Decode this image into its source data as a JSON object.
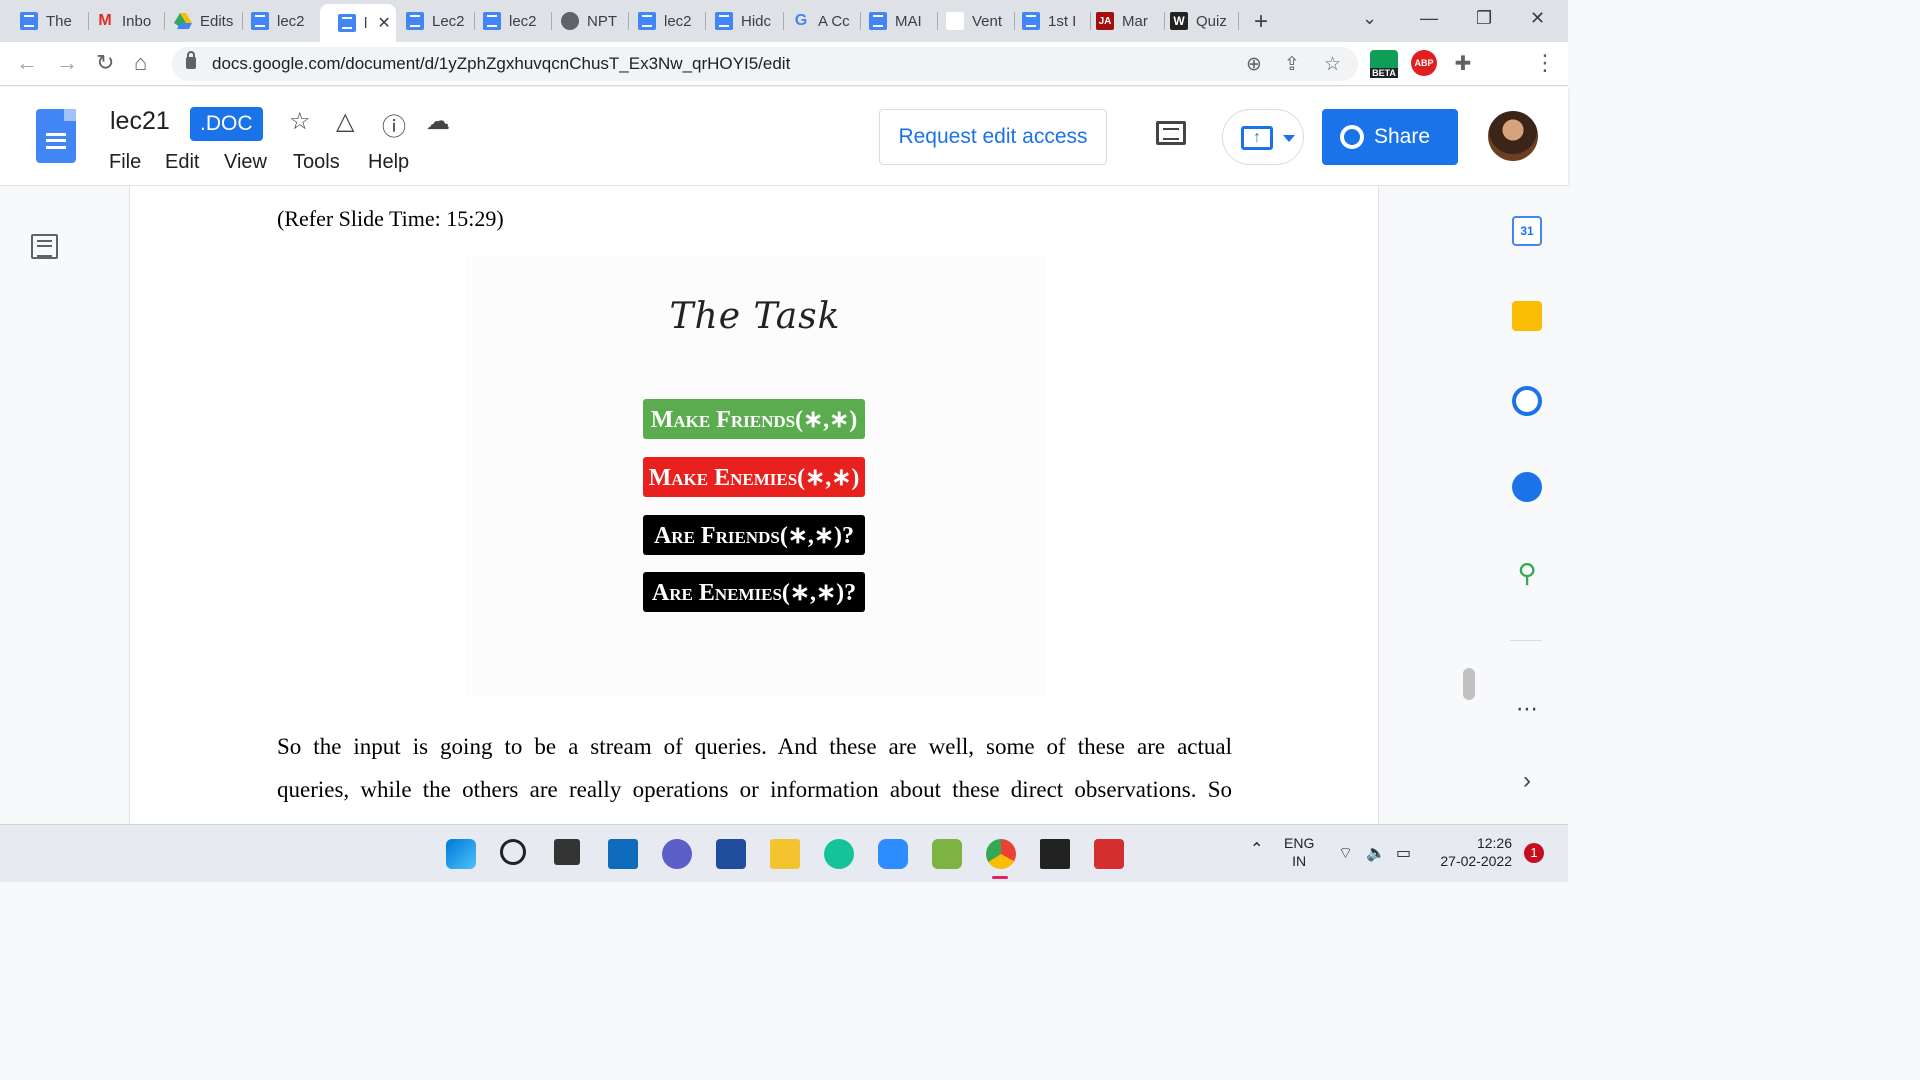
{
  "browser": {
    "tabs": [
      {
        "label": "The",
        "icon": "docs-icon"
      },
      {
        "label": "Inbo",
        "icon": "gmail-icon"
      },
      {
        "label": "Edits",
        "icon": "drive-icon"
      },
      {
        "label": "lec2",
        "icon": "docs-icon"
      },
      {
        "label": "l",
        "icon": "docs-icon",
        "active": true
      },
      {
        "label": "Lec2",
        "icon": "docs-icon"
      },
      {
        "label": "lec2",
        "icon": "docs-icon"
      },
      {
        "label": "NPT",
        "icon": "globe-icon"
      },
      {
        "label": "lec2",
        "icon": "docs-icon"
      },
      {
        "label": "Hidc",
        "icon": "docs-icon"
      },
      {
        "label": "A Cc",
        "icon": "google-icon"
      },
      {
        "label": "MAI",
        "icon": "docs-icon"
      },
      {
        "label": "Vent",
        "icon": "blank-icon"
      },
      {
        "label": "1st I",
        "icon": "docs-icon"
      },
      {
        "label": "Mar",
        "icon": "ja-icon"
      },
      {
        "label": "Quiz",
        "icon": "w-icon"
      }
    ],
    "url": "docs.google.com/document/d/1yZphZgxhuvqcnChusT_Ex3Nw_qrHOYI5/edit",
    "ext_beta": "BETA",
    "ext_abp": "ABP"
  },
  "docs": {
    "title": "lec21",
    "badge": ".DOC",
    "menu": [
      "File",
      "Edit",
      "View",
      "Tools",
      "Help"
    ],
    "request_edit": "Request edit access",
    "share": "Share"
  },
  "document": {
    "refer": "(Refer Slide Time: 15:29)",
    "slide_title": "The Task",
    "pills": [
      {
        "label": "Make Friends(∗,∗)",
        "color": "#5aac4f"
      },
      {
        "label": "Make Enemies(∗,∗)",
        "color": "#e8211f"
      },
      {
        "label": "Are Friends(∗,∗)?",
        "color": "#000000"
      },
      {
        "label": "Are Enemies(∗,∗)?",
        "color": "#000000"
      }
    ],
    "para_line1": "So the input is going to be a stream of queries. And these are well, some of these are actual",
    "para_line2": "queries, while the others are really operations or information about these direct observations. So"
  },
  "side_panel": {
    "calendar_day": "31"
  },
  "taskbar": {
    "lang1": "ENG",
    "lang2": "IN",
    "time": "12:26",
    "date": "27-02-2022",
    "notifications": "1"
  }
}
